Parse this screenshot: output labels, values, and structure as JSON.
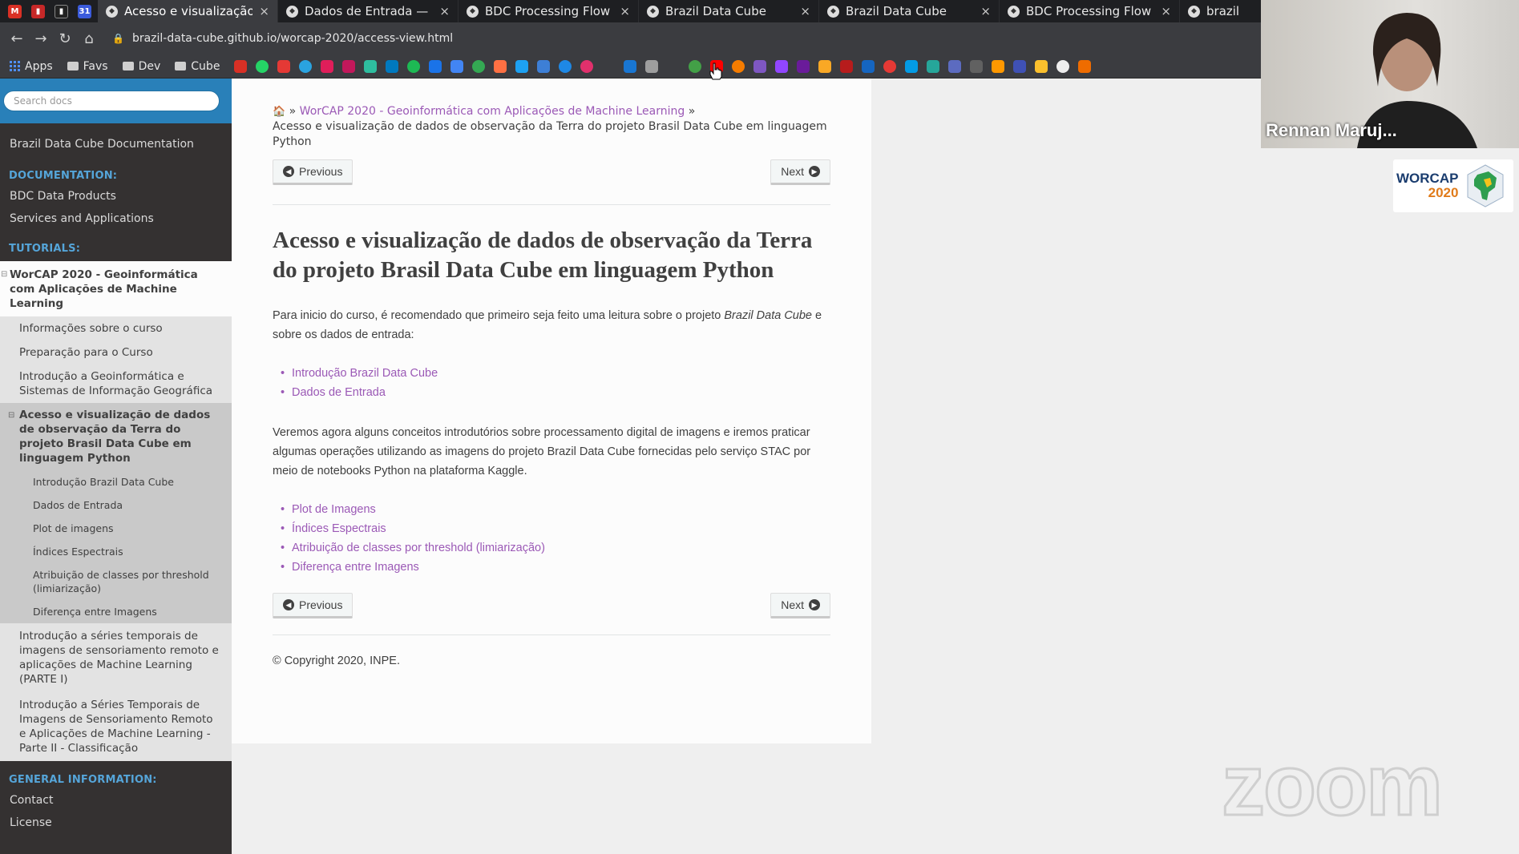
{
  "browser": {
    "tabs": [
      {
        "label": "Acesso e visualização d",
        "active": true
      },
      {
        "label": "Dados de Entrada — Br",
        "active": false
      },
      {
        "label": "BDC Processing Flow -",
        "active": false
      },
      {
        "label": "Brazil Data Cube",
        "active": false
      },
      {
        "label": "Brazil Data Cube",
        "active": false
      },
      {
        "label": "BDC Processing Flow -",
        "active": false
      },
      {
        "label": "brazil",
        "active": false
      }
    ],
    "tab_close": "×",
    "url": "brazil-data-cube.github.io/worcap-2020/access-view.html",
    "bookmarks": {
      "apps": "Apps",
      "favs": "Favs",
      "dev": "Dev",
      "cube": "Cube"
    }
  },
  "sidebar": {
    "search_placeholder": "Search docs",
    "top_link": "Brazil Data Cube Documentation",
    "doc_caption": "DOCUMENTATION:",
    "doc_items": [
      "BDC Data Products",
      "Services and Applications"
    ],
    "tut_caption": "TUTORIALS:",
    "current_l1": "WorCAP 2020 - Geoinformática com Aplicações de Machine Learning",
    "l2_before": [
      "Informações sobre o curso",
      "Preparação para o Curso",
      "Introdução a Geoinformática e Sistemas de Informação Geográfica"
    ],
    "current_l2": "Acesso e visualização de dados de observação da Terra do projeto Brasil Data Cube em linguagem Python",
    "l3": [
      "Introdução Brazil Data Cube",
      "Dados de Entrada",
      "Plot de imagens",
      "Índices Espectrais",
      "Atribuição de classes por threshold (limiarização)",
      "Diferença entre Imagens"
    ],
    "l2_after": [
      "Introdução a séries temporais de imagens de sensoriamento remoto e aplicações de Machine Learning (PARTE I)",
      "Introdução a Séries Temporais de Imagens de Sensoriamento Remoto e Aplicações de Machine Learning - Parte II - Classificação"
    ],
    "gen_caption": "GENERAL INFORMATION:",
    "gen_items": [
      "Contact",
      "License"
    ]
  },
  "content": {
    "breadcrumb_parent": "WorCAP 2020 - Geoinformática com Aplicações de Machine Learning",
    "breadcrumb_sep": "»",
    "breadcrumb_current": "Acesso e visualização de dados de observação da Terra do projeto Brasil Data Cube em linguagem Python",
    "prev_label": "Previous",
    "next_label": "Next",
    "title": "Acesso e visualização de dados de observação da Terra do projeto Brasil Data Cube em linguagem Python",
    "intro_a": "Para inicio do curso, é recomendado que primeiro seja feito uma leitura sobre o projeto ",
    "intro_em": "Brazil Data Cube",
    "intro_b": " e sobre os dados de entrada:",
    "links1": [
      "Introdução Brazil Data Cube",
      "Dados de Entrada"
    ],
    "para2": "Veremos agora alguns conceitos introdutórios sobre processamento digital de imagens e iremos praticar algumas operações utilizando as imagens do projeto Brazil Data Cube fornecidas pelo serviço STAC por meio de notebooks Python na plataforma Kaggle.",
    "links2": [
      "Plot de Imagens",
      "Índices Espectrais",
      "Atribuição de classes por threshold (limiarização)",
      "Diferença entre Imagens"
    ],
    "copyright": "© Copyright 2020, INPE."
  },
  "overlay": {
    "participant_name": "Rennan Maruj...",
    "logo_line1": "WORCAP",
    "logo_line2": "2020",
    "watermark": "zoom"
  }
}
